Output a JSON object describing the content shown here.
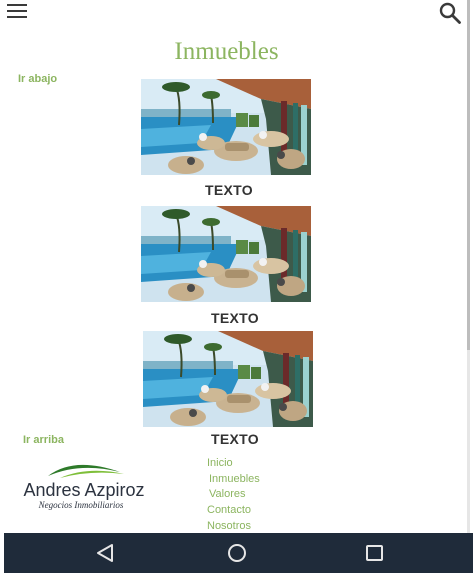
{
  "header": {
    "menu_icon": "hamburger-menu-icon",
    "search_icon": "search-icon"
  },
  "page": {
    "title": "Inmuebles",
    "go_down_link": "Ir abajo",
    "go_up_link": "Ir arriba"
  },
  "listings": [
    {
      "label": "TEXTO",
      "image": "luxury-pool-terrace-photo"
    },
    {
      "label": "TEXTO",
      "image": "luxury-pool-terrace-photo"
    },
    {
      "label": "TEXTO",
      "image": "luxury-pool-terrace-photo"
    }
  ],
  "footer": {
    "logo_name": "Andres Azpiroz",
    "logo_tagline": "Negocios Inmobiliarios",
    "links": [
      "Inicio",
      "Inmuebles",
      "Valores",
      "Contacto",
      "Nosotros"
    ]
  },
  "navbar": {
    "back_icon": "back-triangle-icon",
    "home_icon": "home-circle-icon",
    "recents_icon": "recents-square-icon"
  },
  "colors": {
    "accent": "#8cb560",
    "navbar_bg": "#1f2b3a",
    "text_dark": "#333333"
  }
}
